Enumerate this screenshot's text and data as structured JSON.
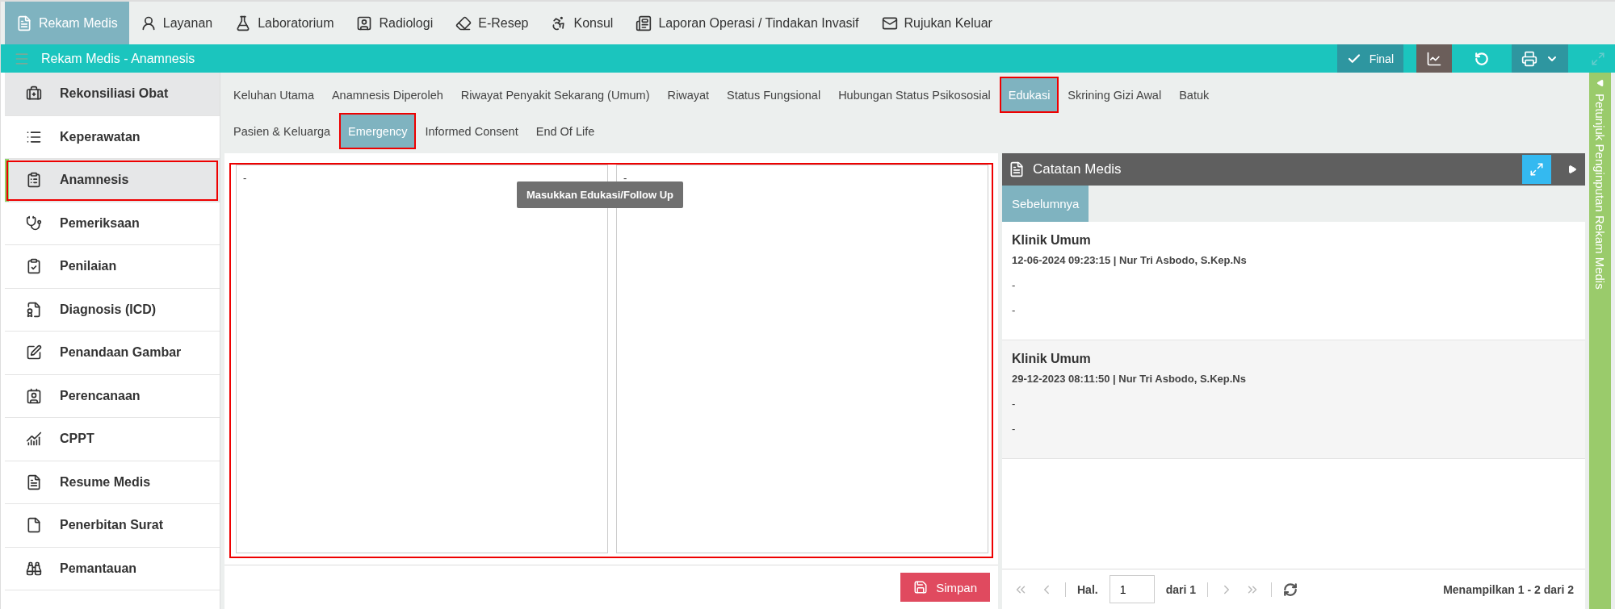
{
  "topnav": [
    {
      "label": "Rekam Medis",
      "selected": true
    },
    {
      "label": "Layanan",
      "selected": false
    },
    {
      "label": "Laboratorium",
      "selected": false
    },
    {
      "label": "Radiologi",
      "selected": false
    },
    {
      "label": "E-Resep",
      "selected": false
    },
    {
      "label": "Konsul",
      "selected": false
    },
    {
      "label": "Laporan Operasi / Tindakan Invasif",
      "selected": false
    },
    {
      "label": "Rujukan Keluar",
      "selected": false
    }
  ],
  "header": {
    "title": "Rekam Medis - Anamnesis",
    "final_label": "Final"
  },
  "sidebar": {
    "items": [
      {
        "label": "Rekonsiliasi Obat",
        "selected": false,
        "hovered": true
      },
      {
        "label": "Keperawatan",
        "selected": false,
        "hovered": false
      },
      {
        "label": "Anamnesis",
        "selected": true,
        "hovered": false
      },
      {
        "label": "Pemeriksaan",
        "selected": false,
        "hovered": false
      },
      {
        "label": "Penilaian",
        "selected": false,
        "hovered": false
      },
      {
        "label": "Diagnosis (ICD)",
        "selected": false,
        "hovered": false
      },
      {
        "label": "Penandaan Gambar",
        "selected": false,
        "hovered": false
      },
      {
        "label": "Perencanaan",
        "selected": false,
        "hovered": false
      },
      {
        "label": "CPPT",
        "selected": false,
        "hovered": false
      },
      {
        "label": "Resume Medis",
        "selected": false,
        "hovered": false
      },
      {
        "label": "Penerbitan Surat",
        "selected": false,
        "hovered": false
      },
      {
        "label": "Pemantauan",
        "selected": false,
        "hovered": false
      }
    ]
  },
  "tabs": [
    {
      "label": "Keluhan Utama",
      "selected": false
    },
    {
      "label": "Anamnesis Diperoleh",
      "selected": false
    },
    {
      "label": "Riwayat Penyakit Sekarang (Umum)",
      "selected": false
    },
    {
      "label": "Riwayat",
      "selected": false
    },
    {
      "label": "Status Fungsional",
      "selected": false
    },
    {
      "label": "Hubungan Status Psikososial",
      "selected": false
    },
    {
      "label": "Edukasi",
      "selected": true
    },
    {
      "label": "Skrining Gizi Awal",
      "selected": false
    },
    {
      "label": "Batuk",
      "selected": false
    },
    {
      "label": "Pasien & Keluarga",
      "selected": false
    },
    {
      "label": "Emergency",
      "selected": true
    },
    {
      "label": "Informed Consent",
      "selected": false
    },
    {
      "label": "End Of Life",
      "selected": false
    }
  ],
  "editor": {
    "fields": [
      {
        "value": "-"
      },
      {
        "value": "-"
      }
    ],
    "tooltip": "Masukkan Edukasi/Follow Up",
    "save_label": "Simpan"
  },
  "records": {
    "title": "Catatan Medis",
    "tab": "Sebelumnya",
    "entries": [
      {
        "title": "Klinik Umum",
        "meta": "12-06-2024 09:23:15 | Nur Tri Asbodo, S.Kep.Ns",
        "lines": [
          "-",
          "-"
        ]
      },
      {
        "title": "Klinik Umum",
        "meta": "29-12-2023 08:11:50 | Nur Tri Asbodo, S.Kep.Ns",
        "lines": [
          "-",
          "-"
        ]
      }
    ],
    "pager": {
      "page_label": "Hal.",
      "page": "1",
      "of": "dari 1",
      "summary": "Menampilkan 1 - 2 dari 2"
    }
  },
  "guide": {
    "label": "Petunjuk Penginputan Rekam Medis"
  }
}
